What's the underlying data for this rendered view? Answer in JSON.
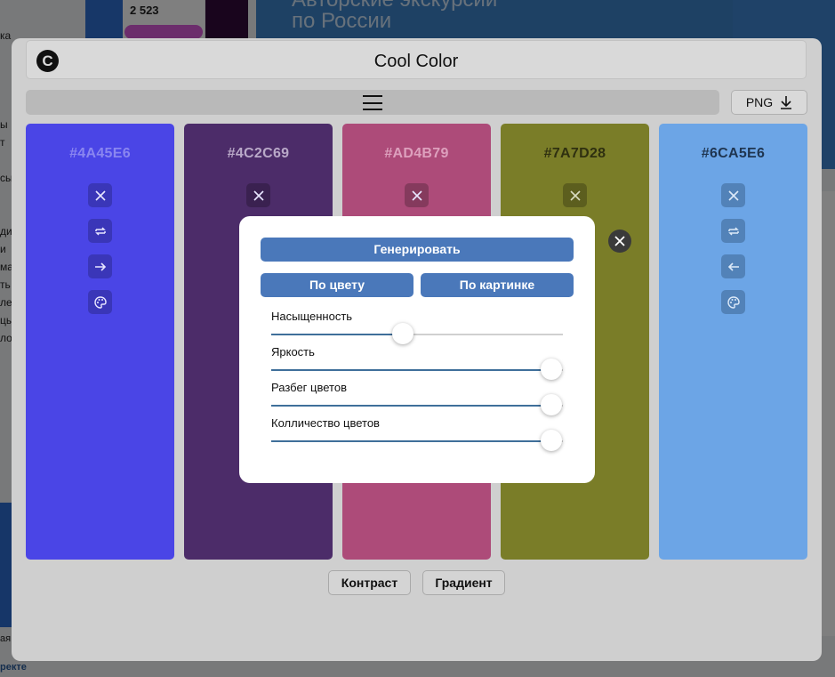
{
  "background": {
    "count": "2 523",
    "banner_line1": "Авторские экскурсий",
    "banner_line2": "по России",
    "left_fragments": [
      "ка",
      "ы",
      "т",
      "сы",
      "ди",
      "и",
      "ма",
      "ть",
      "ле",
      "цы",
      "ло"
    ],
    "bottom_text": "ая р",
    "bottom_link": "ректе"
  },
  "app": {
    "title": "Cool Color",
    "logo_letter": "C",
    "png_label": "PNG"
  },
  "palette": [
    {
      "hex": "#4A45E6",
      "bg": "#4a45e6",
      "text_color": "#8a86f0",
      "ctl_bg": "#3a36b8",
      "icons": [
        "close-icon",
        "refresh-icon",
        "arrow-right-icon",
        "palette-icon"
      ]
    },
    {
      "hex": "#4C2C69",
      "bg": "#4c2c69",
      "text_color": "#b9a9c8",
      "ctl_bg": "#3a2150",
      "icons": [
        "close-icon"
      ]
    },
    {
      "hex": "#AD4B79",
      "bg": "#ad4b79",
      "text_color": "#dda0bd",
      "ctl_bg": "#853a5d",
      "icons": [
        "close-icon"
      ]
    },
    {
      "hex": "#7A7D28",
      "bg": "#7a7d28",
      "text_color": "#2f3010",
      "ctl_bg": "#5c5e1e",
      "icons": [
        "close-icon"
      ]
    },
    {
      "hex": "#6CA5E6",
      "bg": "#6ca5e6",
      "text_color": "#1f3550",
      "ctl_bg": "#5282b8",
      "icons": [
        "close-icon",
        "refresh-icon",
        "arrow-left-icon",
        "palette-icon"
      ]
    }
  ],
  "bottom_buttons": {
    "contrast": "Контраст",
    "gradient": "Градиент"
  },
  "generator": {
    "generate_label": "Генерировать",
    "by_color_label": "По цвету",
    "by_image_label": "По картинке",
    "sliders": [
      {
        "label": "Насыщенность",
        "value": 0.45
      },
      {
        "label": "Яркость",
        "value": 0.96
      },
      {
        "label": "Разбег цветов",
        "value": 0.96
      },
      {
        "label": "Колличество цветов",
        "value": 0.96
      }
    ]
  }
}
